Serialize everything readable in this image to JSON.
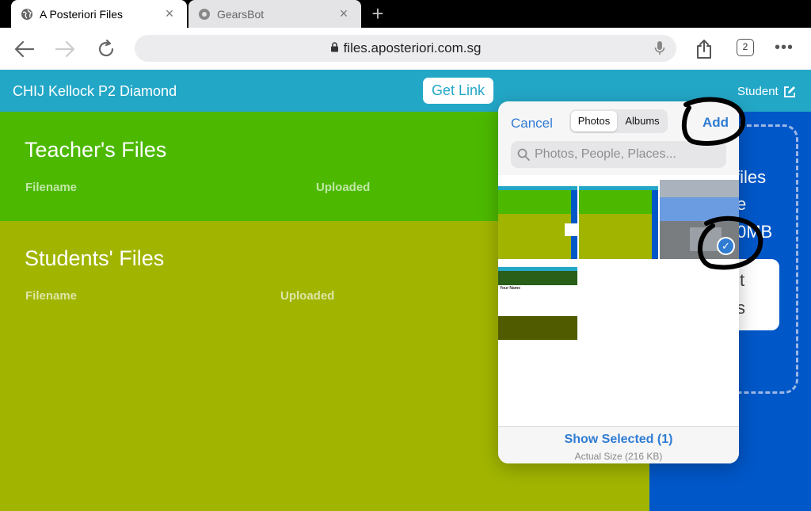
{
  "browser": {
    "tabs": [
      {
        "title": "A Posteriori Files",
        "active": true,
        "favicon": "globe-icon"
      },
      {
        "title": "GearsBot",
        "active": false,
        "favicon": "gears-icon"
      }
    ],
    "tab_close": "×",
    "new_tab": "+",
    "url": "files.aposteriori.com.sg",
    "tab_count": "2",
    "more": "•••"
  },
  "app": {
    "class_name": "CHIJ Kellock P2 Diamond",
    "get_link": "Get Link",
    "role": "Student",
    "teacher_section": {
      "title": "Teacher's Files",
      "col_filename": "Filename",
      "col_uploaded": "Uploaded"
    },
    "students_section": {
      "title": "Students' Files",
      "col_filename": "Filename",
      "col_uploaded": "Uploaded"
    },
    "upload_panel": {
      "line1": "files",
      "line2": "e",
      "line3": "0MB",
      "button_line1": "t",
      "button_line2": "s"
    }
  },
  "picker": {
    "cancel": "Cancel",
    "segments": [
      "Photos",
      "Albums"
    ],
    "selected_segment": "Photos",
    "add": "Add",
    "search_placeholder": "Photos, People, Places...",
    "show_selected": "Show Selected (1)",
    "actual_size": "Actual Size (216 KB)",
    "thumb_caption": "Your Name"
  },
  "colors": {
    "header": "#23a7c7",
    "teacher_bg": "#4cb900",
    "students_bg": "#a1b500",
    "upload_bg": "#0057c8",
    "ios_blue": "#2f7cd3"
  }
}
